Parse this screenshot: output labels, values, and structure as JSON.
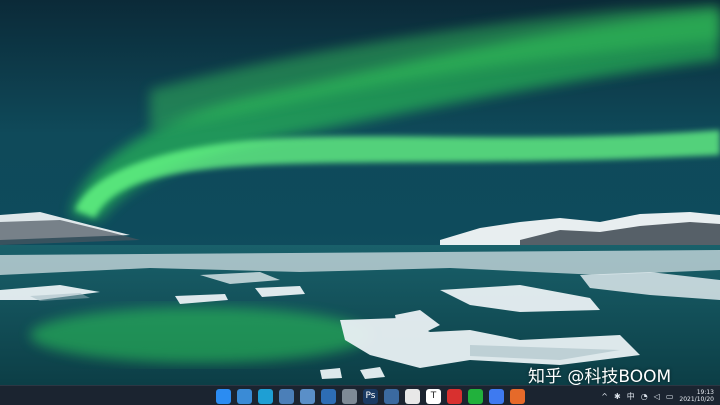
{
  "watermark": {
    "text": "知乎 @科技BOOM"
  },
  "taskbar": {
    "apps": [
      {
        "icon": "windows-start-icon",
        "color": "#2b8cf2"
      },
      {
        "icon": "desktop-icon",
        "color": "#3a8bd6"
      },
      {
        "icon": "edge-browser-icon",
        "color": "#1e9fd4"
      },
      {
        "icon": "mail-icon",
        "color": "#4b7fb8"
      },
      {
        "icon": "monitor-icon",
        "color": "#5a8fc8"
      },
      {
        "icon": "store-icon",
        "color": "#2d6db5"
      },
      {
        "icon": "settings-gear-icon",
        "color": "#7e8a96"
      },
      {
        "icon": "photoshop-icon",
        "color": "#1a3a63",
        "label": "Ps"
      },
      {
        "icon": "calendar-icon",
        "color": "#3b6aa0"
      },
      {
        "icon": "qq-penguin-icon",
        "color": "#e8e8e8"
      },
      {
        "icon": "typora-icon",
        "color": "#ffffff",
        "label": "T"
      },
      {
        "icon": "netease-music-icon",
        "color": "#d8302f"
      },
      {
        "icon": "wechat-icon",
        "color": "#21b13c"
      },
      {
        "icon": "feishu-icon",
        "color": "#3e7af0"
      },
      {
        "icon": "firefox-icon",
        "color": "#e66a2a"
      }
    ],
    "tray": {
      "chevron": "^",
      "ime": "中",
      "time": "19:13",
      "date": "2021/10/20"
    }
  }
}
